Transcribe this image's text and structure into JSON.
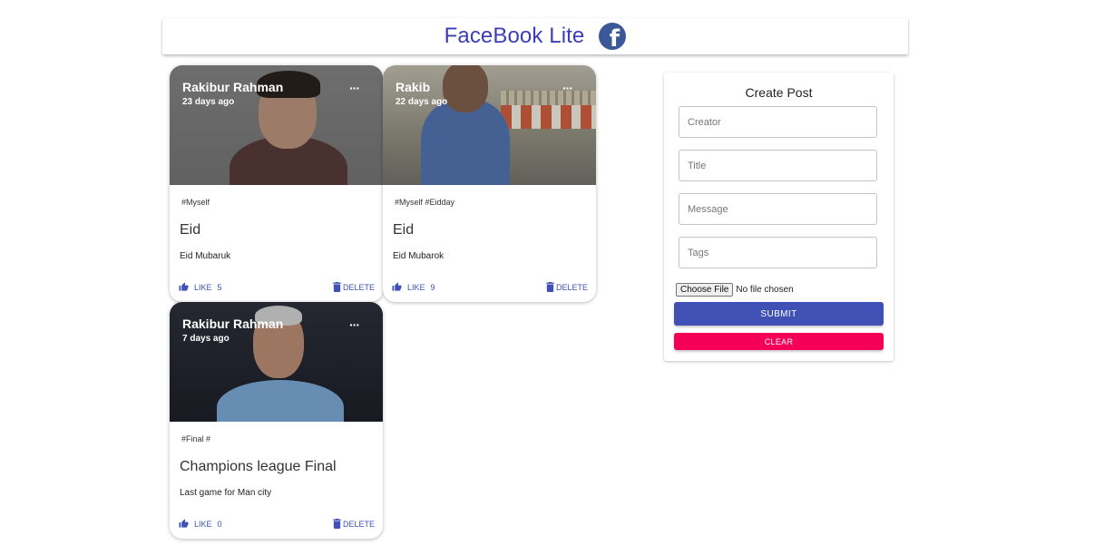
{
  "header": {
    "title": "FaceBook Lite",
    "logo_icon": "facebook-icon",
    "brand_color": "#3b3fb5",
    "logo_color": "#3b5998"
  },
  "posts": [
    {
      "creator": "Rakibur Rahman",
      "time_ago": "23 days ago",
      "tags": "#Myself",
      "title": "Eid",
      "message": "Eid Mubaruk",
      "like_label": "LIKE",
      "like_count": "5",
      "delete_label": "DELETE",
      "more_label": "···"
    },
    {
      "creator": "Rakib",
      "time_ago": "22 days ago",
      "tags": "#Myself #Eidday",
      "title": "Eid",
      "message": "Eid Mubarok",
      "like_label": "LIKE",
      "like_count": "9",
      "delete_label": "DELETE",
      "more_label": "···"
    },
    {
      "creator": "Rakibur Rahman",
      "time_ago": "7 days ago",
      "tags": "#Final #",
      "title": "Champions league Final",
      "message": "Last game for Man city",
      "like_label": "LIKE",
      "like_count": "0",
      "delete_label": "DELETE",
      "more_label": "···"
    }
  ],
  "form": {
    "title": "Create Post",
    "creator_placeholder": "Creator",
    "title_placeholder": "Title",
    "message_placeholder": "Message",
    "tags_placeholder": "Tags",
    "choose_file_label": "Choose File",
    "no_file_text": "No file chosen",
    "submit_label": "SUBMIT",
    "clear_label": "CLEAR",
    "primary_color": "#3f51b5",
    "secondary_color": "#f50057"
  }
}
